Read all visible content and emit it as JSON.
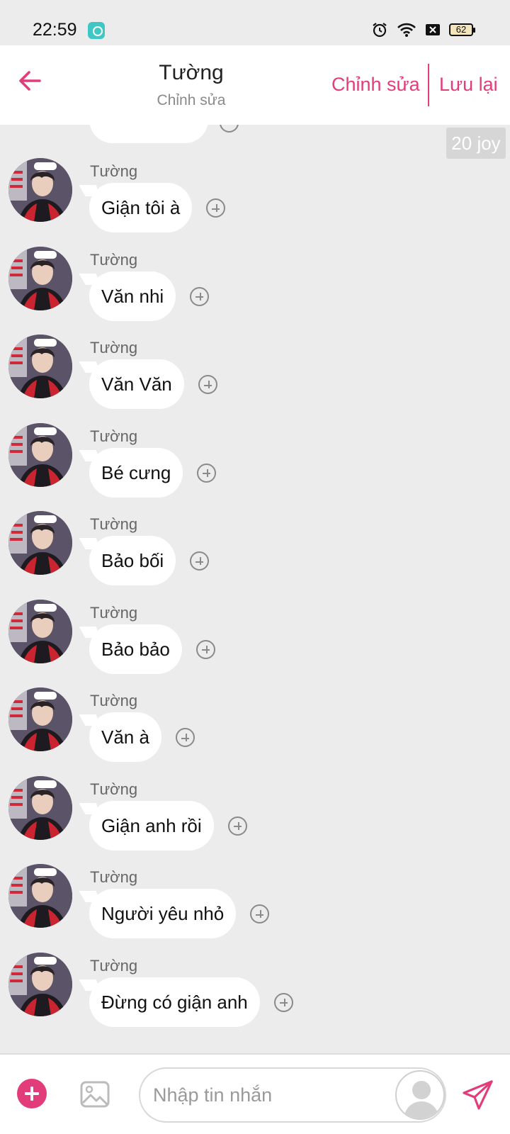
{
  "status_bar": {
    "time": "22:59",
    "battery": "62"
  },
  "header": {
    "title": "Tường",
    "subtitle": "Chỉnh sửa",
    "edit_label": "Chỉnh sửa",
    "save_label": "Lưu lại"
  },
  "chat": {
    "badge": "20 joy",
    "messages": [
      {
        "sender": "Tường",
        "text": "Giận tôi à"
      },
      {
        "sender": "Tường",
        "text": "Văn nhi"
      },
      {
        "sender": "Tường",
        "text": "Văn Văn"
      },
      {
        "sender": "Tường",
        "text": "Bé cưng"
      },
      {
        "sender": "Tường",
        "text": "Bảo bối"
      },
      {
        "sender": "Tường",
        "text": "Bảo bảo"
      },
      {
        "sender": "Tường",
        "text": "Văn à"
      },
      {
        "sender": "Tường",
        "text": "Giận anh rồi"
      },
      {
        "sender": "Tường",
        "text": "Người yêu nhỏ"
      },
      {
        "sender": "Tường",
        "text": "Đừng có giận anh"
      }
    ]
  },
  "footer": {
    "input_placeholder": "Nhập tin nhắn"
  },
  "colors": {
    "accent": "#e23d7a",
    "background": "#ececec",
    "bubble": "#ffffff"
  }
}
